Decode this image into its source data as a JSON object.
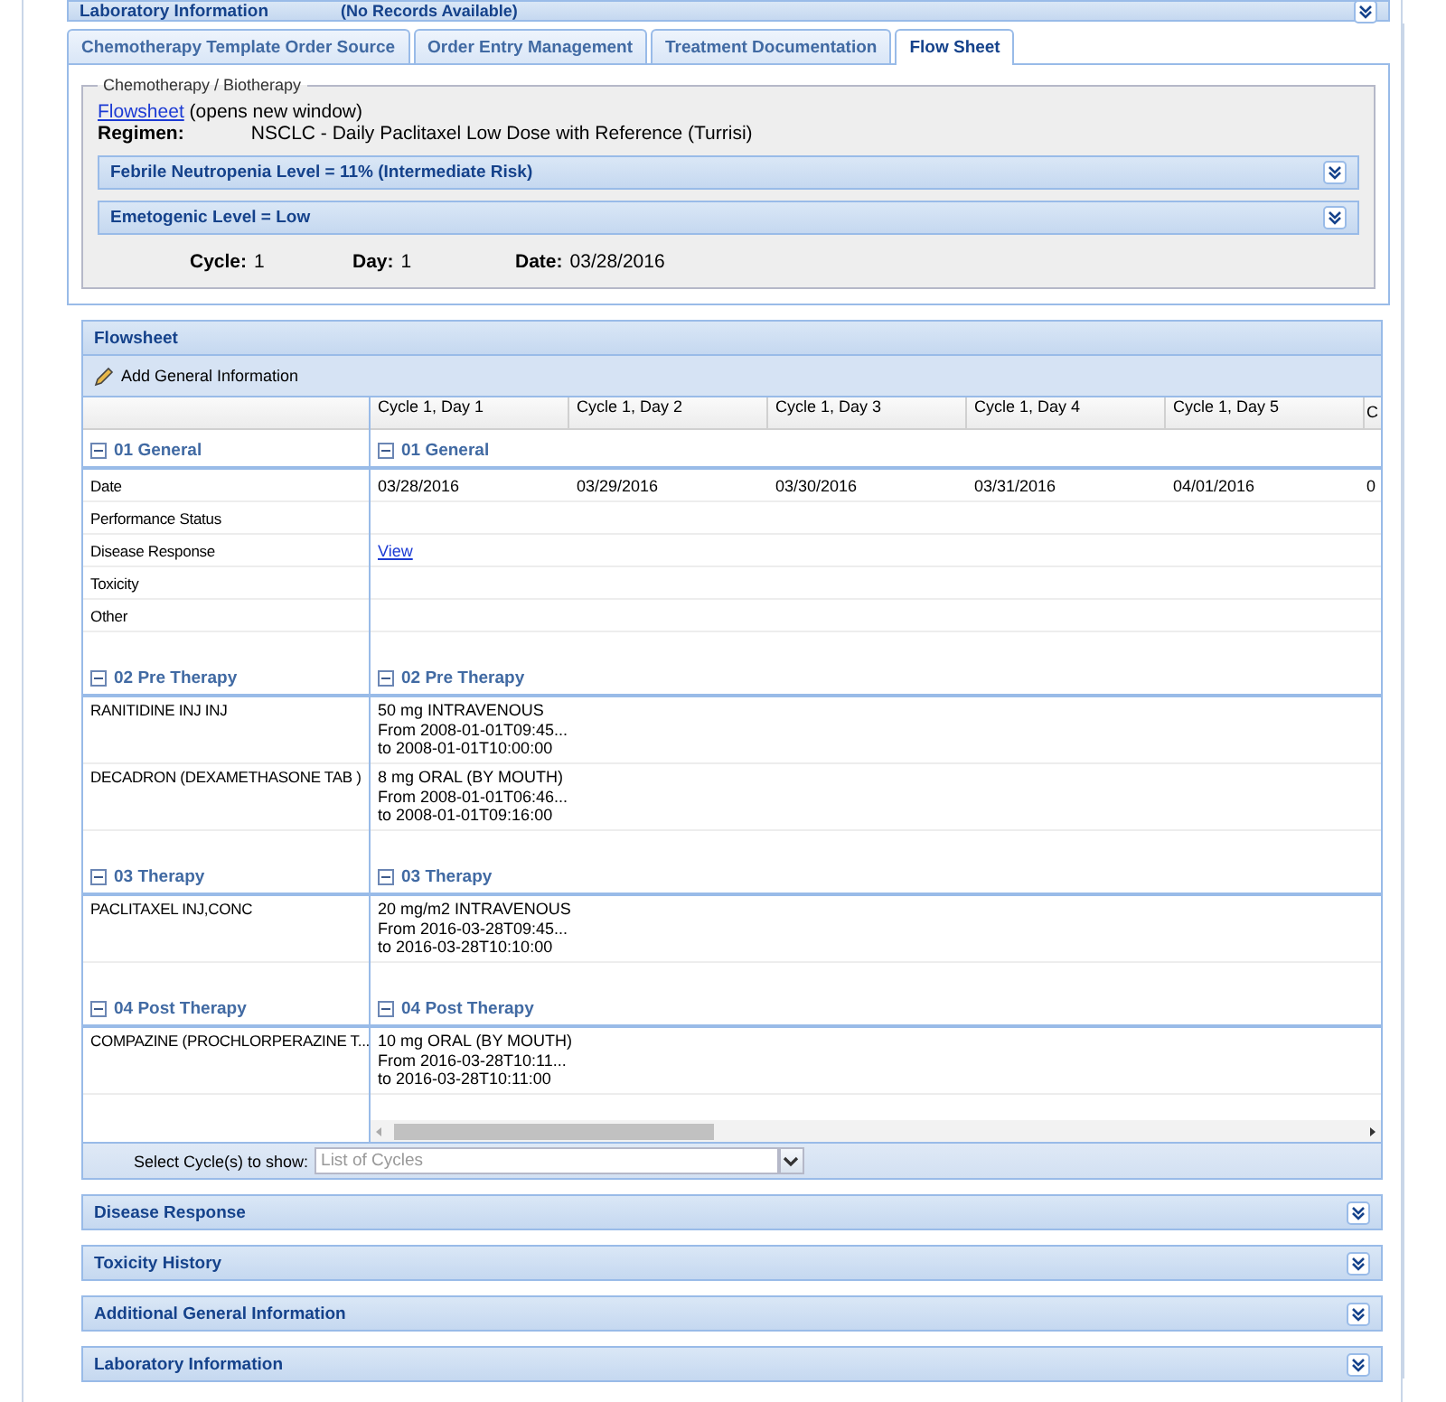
{
  "top_panel": {
    "title": "Laboratory Information",
    "note": "(No Records Available)",
    "expanded": false
  },
  "tabs": [
    {
      "label": "Chemotherapy Template Order Source",
      "selected": false
    },
    {
      "label": "Order Entry Management",
      "selected": false
    },
    {
      "label": "Treatment Documentation",
      "selected": false
    },
    {
      "label": "Flow Sheet",
      "selected": true
    }
  ],
  "chemo": {
    "legend": "Chemotherapy / Biotherapy",
    "link": "Flowsheet",
    "link_note": "(opens new window)",
    "regimen_label": "Regimen:",
    "regimen": "NSCLC - Daily Paclitaxel Low Dose with Reference (Turrisi)",
    "panels": [
      {
        "title": "Febrile Neutropenia Level = 11% (Intermediate Risk)",
        "expanded": false
      },
      {
        "title": "Emetogenic Level = Low",
        "expanded": false
      }
    ],
    "cycle_info": [
      {
        "label": "Cycle:",
        "value": "1"
      },
      {
        "label": "Day:",
        "value": "1"
      },
      {
        "label": "Date:",
        "value": "03/28/2016"
      }
    ]
  },
  "flowsheet": {
    "title": "Flowsheet",
    "add_button": "Add General Information",
    "columns": [
      "Cycle 1, Day 1",
      "Cycle 1, Day 2",
      "Cycle 1, Day 3",
      "Cycle 1, Day 4",
      "Cycle 1, Day 5",
      "C"
    ],
    "sections": [
      {
        "title": "01 General",
        "title_right": "01 General",
        "expanded": true,
        "rows": [
          {
            "label": "Date",
            "cells": [
              {
                "kind": "text",
                "text": "03/28/2016"
              },
              {
                "kind": "text",
                "text": "03/29/2016"
              },
              {
                "kind": "text",
                "text": "03/30/2016"
              },
              {
                "kind": "text",
                "text": "03/31/2016"
              },
              {
                "kind": "text",
                "text": "04/01/2016"
              },
              {
                "kind": "text",
                "text": "0"
              }
            ]
          },
          {
            "label": "Performance Status"
          },
          {
            "label": "Disease Response",
            "cells": [
              {
                "kind": "link",
                "text": "View"
              }
            ]
          },
          {
            "label": "Toxicity"
          },
          {
            "label": "Other"
          }
        ]
      },
      {
        "title": "02 Pre Therapy",
        "title_right": "02 Pre Therapy",
        "expanded": true,
        "rows": [
          {
            "label": "RANITIDINE INJ INJ",
            "cells": [
              {
                "kind": "dose",
                "lines": [
                  "50 mg INTRAVENOUS",
                  "From 2008-01-01T09:45...",
                  "to 2008-01-01T10:00:00"
                ]
              }
            ]
          },
          {
            "label": "DECADRON (DEXAMETHASONE TAB )",
            "cells": [
              {
                "kind": "dose",
                "lines": [
                  "8 mg ORAL (BY MOUTH)",
                  "From 2008-01-01T06:46...",
                  "to 2008-01-01T09:16:00"
                ]
              }
            ]
          }
        ]
      },
      {
        "title": "03 Therapy",
        "title_right": "03 Therapy",
        "expanded": true,
        "rows": [
          {
            "label": "PACLITAXEL INJ,CONC",
            "cells": [
              {
                "kind": "dose",
                "lines": [
                  "20 mg/m2 INTRAVENOUS",
                  "From 2016-03-28T09:45...",
                  "to 2016-03-28T10:10:00"
                ]
              }
            ]
          }
        ]
      },
      {
        "title": "04 Post Therapy",
        "title_right": "04 Post Therapy",
        "expanded": true,
        "rows": [
          {
            "label": "COMPAZINE (PROCHLORPERAZINE T...",
            "cells": [
              {
                "kind": "dose",
                "lines": [
                  "10 mg ORAL (BY MOUTH)",
                  "From 2016-03-28T10:11...",
                  "to 2016-03-28T10:11:00"
                ]
              }
            ]
          }
        ]
      }
    ],
    "select_label": "Select Cycle(s) to show:",
    "select_placeholder": "List of Cycles"
  },
  "bottom_panels": [
    {
      "title": "Disease Response",
      "expanded": false
    },
    {
      "title": "Toxicity History",
      "expanded": false
    },
    {
      "title": "Additional General Information",
      "expanded": false
    },
    {
      "title": "Laboratory Information",
      "expanded": false
    }
  ]
}
